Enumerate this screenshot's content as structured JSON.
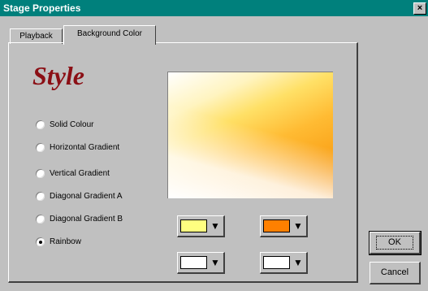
{
  "window": {
    "title": "Stage Properties",
    "close_glyph": "×"
  },
  "tabs": [
    {
      "label": "Playback",
      "active": false
    },
    {
      "label": "Background Color",
      "active": true
    }
  ],
  "style": {
    "heading": "Style",
    "options": [
      {
        "label": "Solid Colour",
        "checked": false
      },
      {
        "label": "Horizontal Gradient",
        "checked": false
      },
      {
        "label": "Vertical Gradient",
        "checked": false
      },
      {
        "label": "Diagonal Gradient A",
        "checked": false
      },
      {
        "label": "Diagonal Gradient B",
        "checked": false
      },
      {
        "label": "Rainbow",
        "checked": true
      }
    ]
  },
  "preview": {
    "colors": [
      "#ffffff",
      "#ffe066",
      "#f48a00"
    ]
  },
  "swatches": [
    {
      "color": "#ffff80",
      "arrow": "▼"
    },
    {
      "color": "#ff8000",
      "arrow": "▼"
    },
    {
      "color": "#ffffff",
      "arrow": "▼"
    },
    {
      "color": "#ffffff",
      "arrow": "▼"
    }
  ],
  "buttons": {
    "ok": "OK",
    "cancel": "Cancel"
  }
}
